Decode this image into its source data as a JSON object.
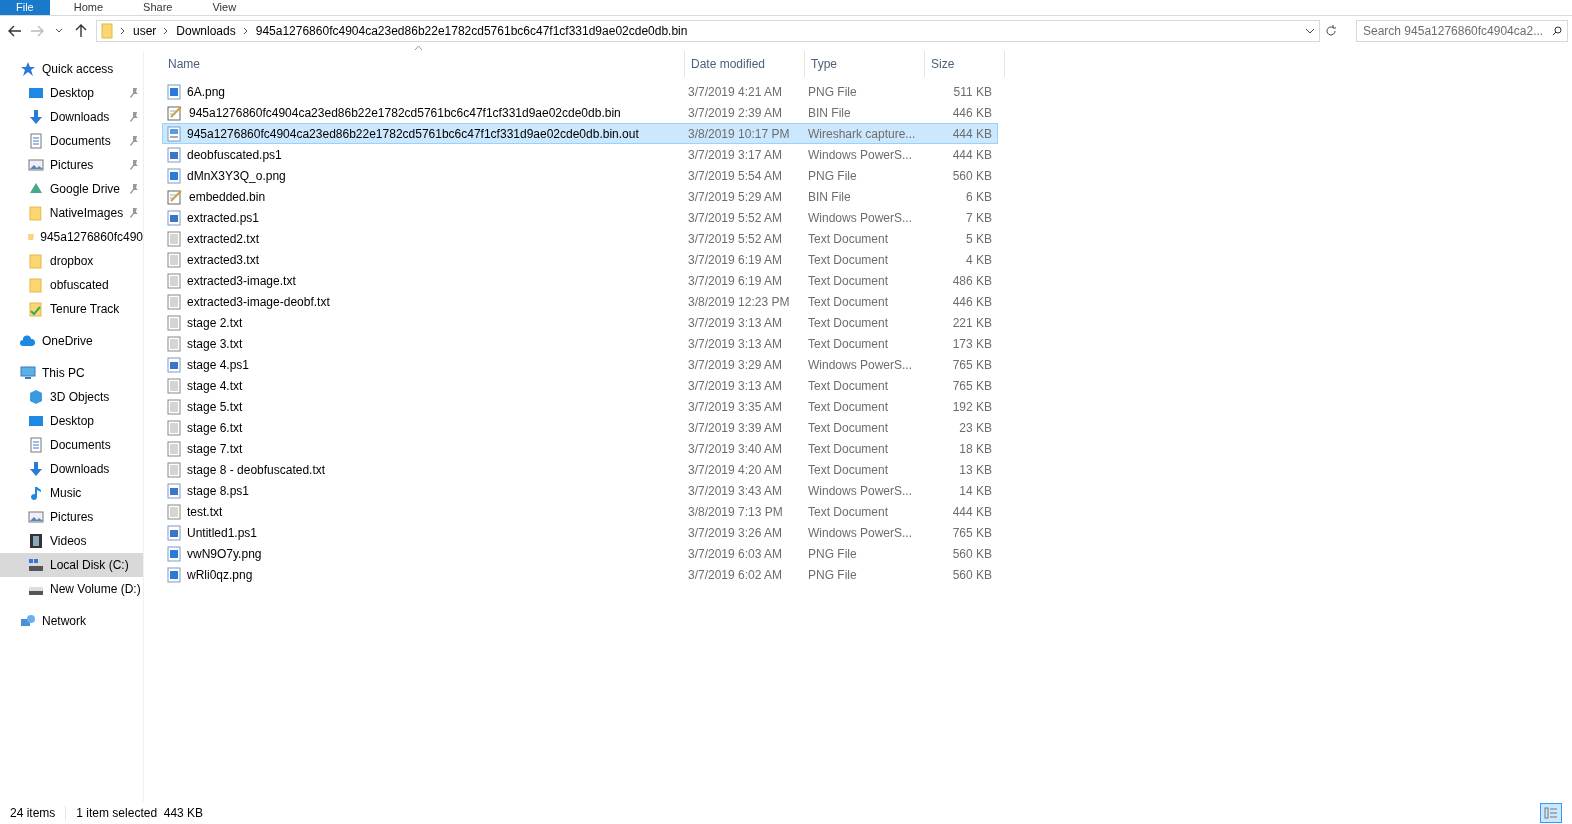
{
  "ribbon_tabs": [
    {
      "label": "File",
      "selected": true
    },
    {
      "label": "Home",
      "selected": false
    },
    {
      "label": "Share",
      "selected": false
    },
    {
      "label": "View",
      "selected": false
    }
  ],
  "address_bar": {
    "path": [
      "user",
      "Downloads",
      "945a1276860fc4904ca23ed86b22e1782cd5761bc6c47f1cf331d9ae02cde0db.bin"
    ]
  },
  "search": {
    "placeholder": "Search 945a1276860fc4904ca2..."
  },
  "sidebar": {
    "items": [
      {
        "label": "Quick access",
        "kind": "star",
        "selected": false,
        "children": [
          {
            "label": "Desktop",
            "kind": "desktop",
            "pinned": true,
            "selected": false
          },
          {
            "label": "Downloads",
            "kind": "download",
            "pinned": true,
            "selected": false
          },
          {
            "label": "Documents",
            "kind": "document",
            "pinned": true,
            "selected": false
          },
          {
            "label": "Pictures",
            "kind": "picture",
            "pinned": true,
            "selected": false
          },
          {
            "label": "Google Drive",
            "kind": "drive",
            "pinned": true,
            "selected": false
          },
          {
            "label": "NativeImages",
            "kind": "folder",
            "pinned": true,
            "selected": false
          },
          {
            "label": "945a1276860fc490",
            "kind": "folder",
            "pinned": false,
            "selected": false
          },
          {
            "label": "dropbox",
            "kind": "folder",
            "pinned": false,
            "selected": false
          },
          {
            "label": "obfuscated",
            "kind": "folder",
            "pinned": false,
            "selected": false
          },
          {
            "label": "Tenure Track",
            "kind": "folder-check",
            "pinned": false,
            "selected": false
          }
        ]
      },
      {
        "label": "OneDrive",
        "kind": "cloud",
        "selected": false
      },
      {
        "label": "This PC",
        "kind": "computer",
        "selected": false,
        "children": [
          {
            "label": "3D Objects",
            "kind": "cube",
            "pinned": false,
            "selected": false
          },
          {
            "label": "Desktop",
            "kind": "desktop",
            "pinned": false,
            "selected": false
          },
          {
            "label": "Documents",
            "kind": "document",
            "pinned": false,
            "selected": false
          },
          {
            "label": "Downloads",
            "kind": "download",
            "pinned": false,
            "selected": false
          },
          {
            "label": "Music",
            "kind": "music",
            "pinned": false,
            "selected": false
          },
          {
            "label": "Pictures",
            "kind": "picture",
            "pinned": false,
            "selected": false
          },
          {
            "label": "Videos",
            "kind": "video",
            "pinned": false,
            "selected": false
          },
          {
            "label": "Local Disk (C:)",
            "kind": "disk",
            "pinned": false,
            "selected": true
          },
          {
            "label": "New Volume (D:)",
            "kind": "drive-disk",
            "pinned": false,
            "selected": false
          }
        ]
      },
      {
        "label": "Network",
        "kind": "network",
        "selected": false
      }
    ]
  },
  "table": {
    "columns": [
      "Name",
      "Date modified",
      "Type",
      "Size"
    ],
    "rows": [
      {
        "kind": "image",
        "name": "6A.png",
        "date": "3/7/2019 4:21 AM",
        "type": "PNG File",
        "size": "511 KB",
        "selected": false
      },
      {
        "kind": "bin",
        "name": "945a1276860fc4904ca23ed86b22e1782cd5761bc6c47f1cf331d9ae02cde0db.bin",
        "date": "3/7/2019 2:39 AM",
        "type": "BIN File",
        "size": "446 KB",
        "selected": false
      },
      {
        "kind": "capture",
        "name": "945a1276860fc4904ca23ed86b22e1782cd5761bc6c47f1cf331d9ae02cde0db.bin.out",
        "date": "3/8/2019 10:17 PM",
        "type": "Wireshark capture...",
        "size": "444 KB",
        "selected": true
      },
      {
        "kind": "script",
        "name": "deobfuscated.ps1",
        "date": "3/7/2019 3:17 AM",
        "type": "Windows PowerS...",
        "size": "444 KB",
        "selected": false
      },
      {
        "kind": "image",
        "name": "dMnX3Y3Q_o.png",
        "date": "3/7/2019 5:54 AM",
        "type": "PNG File",
        "size": "560 KB",
        "selected": false
      },
      {
        "kind": "bin",
        "name": "embedded.bin",
        "date": "3/7/2019 5:29 AM",
        "type": "BIN File",
        "size": "6 KB",
        "selected": false
      },
      {
        "kind": "script",
        "name": "extracted.ps1",
        "date": "3/7/2019 5:52 AM",
        "type": "Windows PowerS...",
        "size": "7 KB",
        "selected": false
      },
      {
        "kind": "text",
        "name": "extracted2.txt",
        "date": "3/7/2019 5:52 AM",
        "type": "Text Document",
        "size": "5 KB",
        "selected": false
      },
      {
        "kind": "text",
        "name": "extracted3.txt",
        "date": "3/7/2019 6:19 AM",
        "type": "Text Document",
        "size": "4 KB",
        "selected": false
      },
      {
        "kind": "text",
        "name": "extracted3-image.txt",
        "date": "3/7/2019 6:19 AM",
        "type": "Text Document",
        "size": "486 KB",
        "selected": false
      },
      {
        "kind": "text",
        "name": "extracted3-image-deobf.txt",
        "date": "3/8/2019 12:23 PM",
        "type": "Text Document",
        "size": "446 KB",
        "selected": false
      },
      {
        "kind": "text",
        "name": "stage 2.txt",
        "date": "3/7/2019 3:13 AM",
        "type": "Text Document",
        "size": "221 KB",
        "selected": false
      },
      {
        "kind": "text",
        "name": "stage 3.txt",
        "date": "3/7/2019 3:13 AM",
        "type": "Text Document",
        "size": "173 KB",
        "selected": false
      },
      {
        "kind": "script",
        "name": "stage 4.ps1",
        "date": "3/7/2019 3:29 AM",
        "type": "Windows PowerS...",
        "size": "765 KB",
        "selected": false
      },
      {
        "kind": "text",
        "name": "stage 4.txt",
        "date": "3/7/2019 3:13 AM",
        "type": "Text Document",
        "size": "765 KB",
        "selected": false
      },
      {
        "kind": "text",
        "name": "stage 5.txt",
        "date": "3/7/2019 3:35 AM",
        "type": "Text Document",
        "size": "192 KB",
        "selected": false
      },
      {
        "kind": "text",
        "name": "stage 6.txt",
        "date": "3/7/2019 3:39 AM",
        "type": "Text Document",
        "size": "23 KB",
        "selected": false
      },
      {
        "kind": "text",
        "name": "stage 7.txt",
        "date": "3/7/2019 3:40 AM",
        "type": "Text Document",
        "size": "18 KB",
        "selected": false
      },
      {
        "kind": "text",
        "name": "stage 8 - deobfuscated.txt",
        "date": "3/7/2019 4:20 AM",
        "type": "Text Document",
        "size": "13 KB",
        "selected": false
      },
      {
        "kind": "script",
        "name": "stage 8.ps1",
        "date": "3/7/2019 3:43 AM",
        "type": "Windows PowerS...",
        "size": "14 KB",
        "selected": false
      },
      {
        "kind": "text",
        "name": "test.txt",
        "date": "3/8/2019 7:13 PM",
        "type": "Text Document",
        "size": "444 KB",
        "selected": false
      },
      {
        "kind": "script",
        "name": "Untitled1.ps1",
        "date": "3/7/2019 3:26 AM",
        "type": "Windows PowerS...",
        "size": "765 KB",
        "selected": false
      },
      {
        "kind": "image",
        "name": "vwN9O7y.png",
        "date": "3/7/2019 6:03 AM",
        "type": "PNG File",
        "size": "560 KB",
        "selected": false
      },
      {
        "kind": "image",
        "name": "wRli0qz.png",
        "date": "3/7/2019 6:02 AM",
        "type": "PNG File",
        "size": "560 KB",
        "selected": false
      }
    ]
  },
  "status_bar": {
    "count": "24 items",
    "selection": "1 item selected  443 KB"
  }
}
